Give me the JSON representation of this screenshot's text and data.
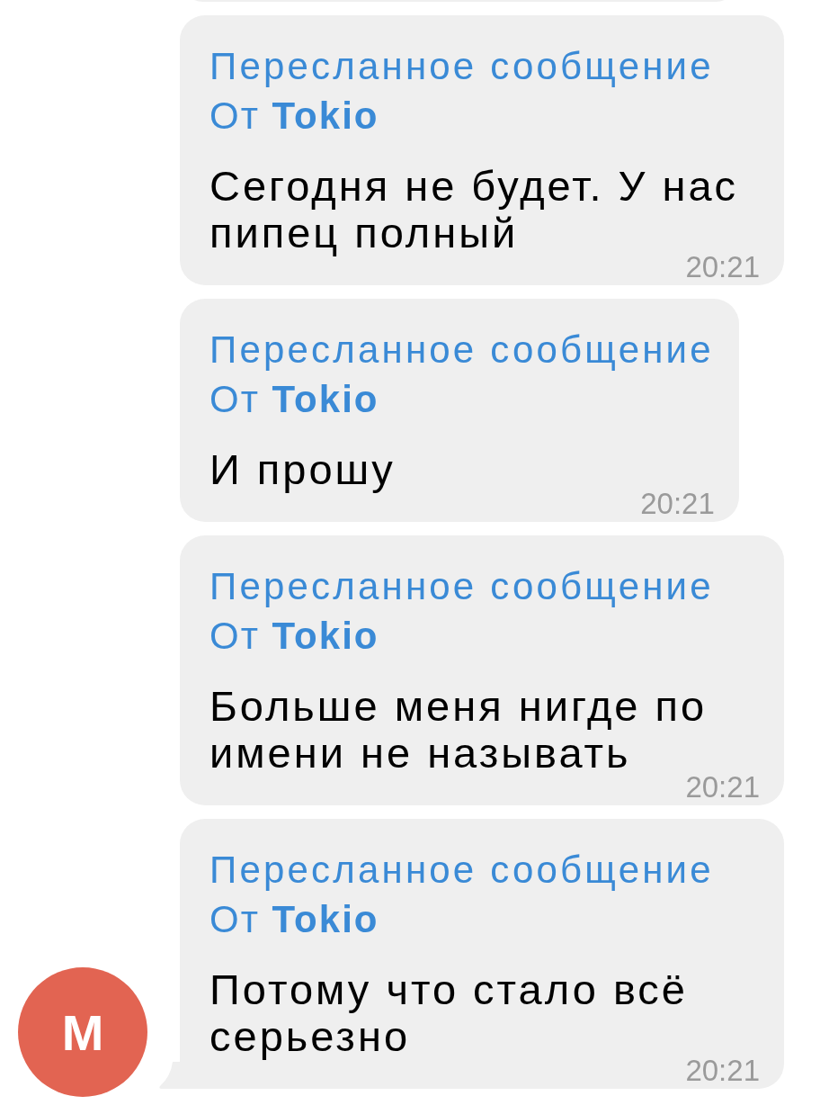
{
  "messages": [
    {
      "forwarded_label": "Пересланное сообщение",
      "from": "От **Tokio**",
      "text": "Сегодня не будет. У нас пипец полный",
      "time": "20:21",
      "tail": false
    },
    {
      "forwarded_label": "Пересланное сообщение",
      "from": "От **Tokio**",
      "text": "И прошу",
      "time": "20:21",
      "tail": false
    },
    {
      "forwarded_label": "Пересланное сообщение",
      "from": "От **Tokio**",
      "text": "Больше меня нигде по имени не называть",
      "time": "20:21",
      "tail": false
    },
    {
      "forwarded_label": "Пересланное сообщение",
      "from": "От **Tokio**",
      "text": "Потому что стало всё серьезно",
      "time": "20:21",
      "tail": true
    }
  ],
  "avatar": {
    "initial": "M",
    "color": "#e26452"
  }
}
